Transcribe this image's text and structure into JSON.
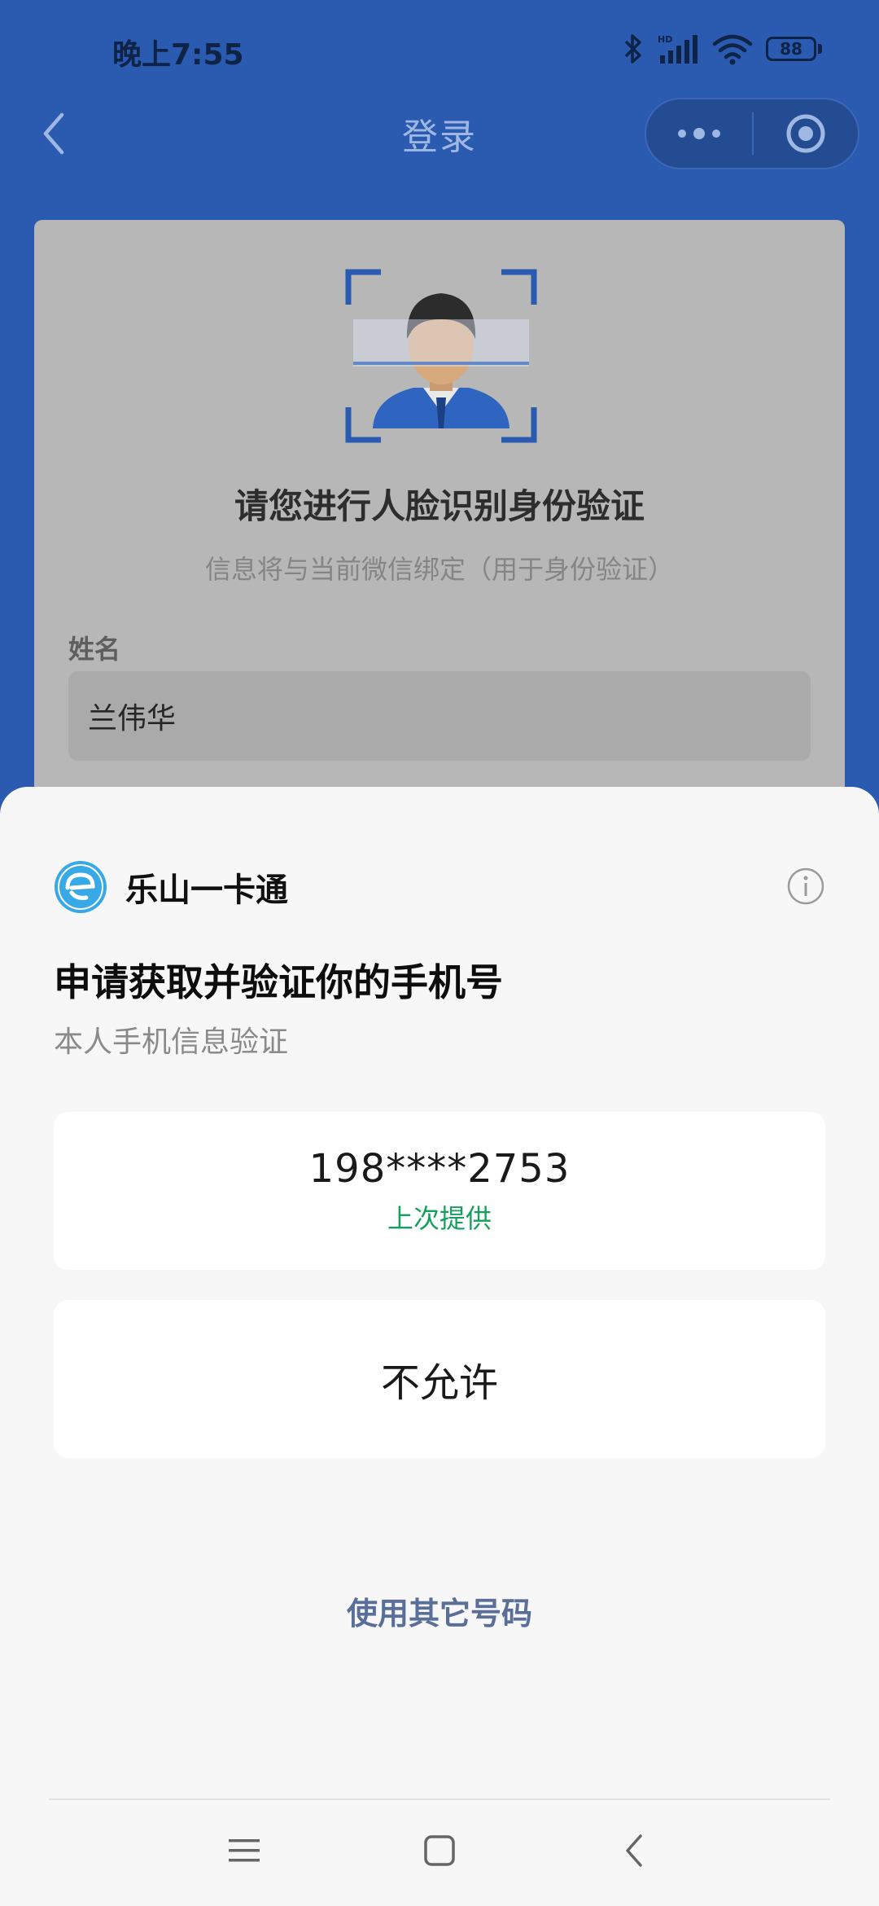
{
  "status_bar": {
    "time": "晚上7:55",
    "battery": "88",
    "icons": [
      "bluetooth-icon",
      "hd-signal-icon",
      "wifi-icon",
      "battery-icon"
    ]
  },
  "nav": {
    "title": "登录",
    "back_icon": "back-arrow-icon",
    "more_icon": "more-dots-icon",
    "close_icon": "miniprogram-close-icon"
  },
  "card": {
    "title": "请您进行人脸识别身份验证",
    "subtitle": "信息将与当前微信绑定（用于身份验证）",
    "name_label": "姓名",
    "name_value": "兰伟华"
  },
  "sheet": {
    "app_name": "乐山一卡通",
    "title": "申请获取并验证你的手机号",
    "description": "本人手机信息验证",
    "phone_option": {
      "number": "198****2753",
      "hint": "上次提供"
    },
    "deny_label": "不允许",
    "other_number_label": "使用其它号码"
  },
  "system_nav": [
    "menu-icon",
    "home-icon",
    "back-icon"
  ],
  "colors": {
    "header_blue": "#2a5bb0",
    "accent_green": "#16a05d",
    "link_blue_gray": "#5a6f98"
  }
}
